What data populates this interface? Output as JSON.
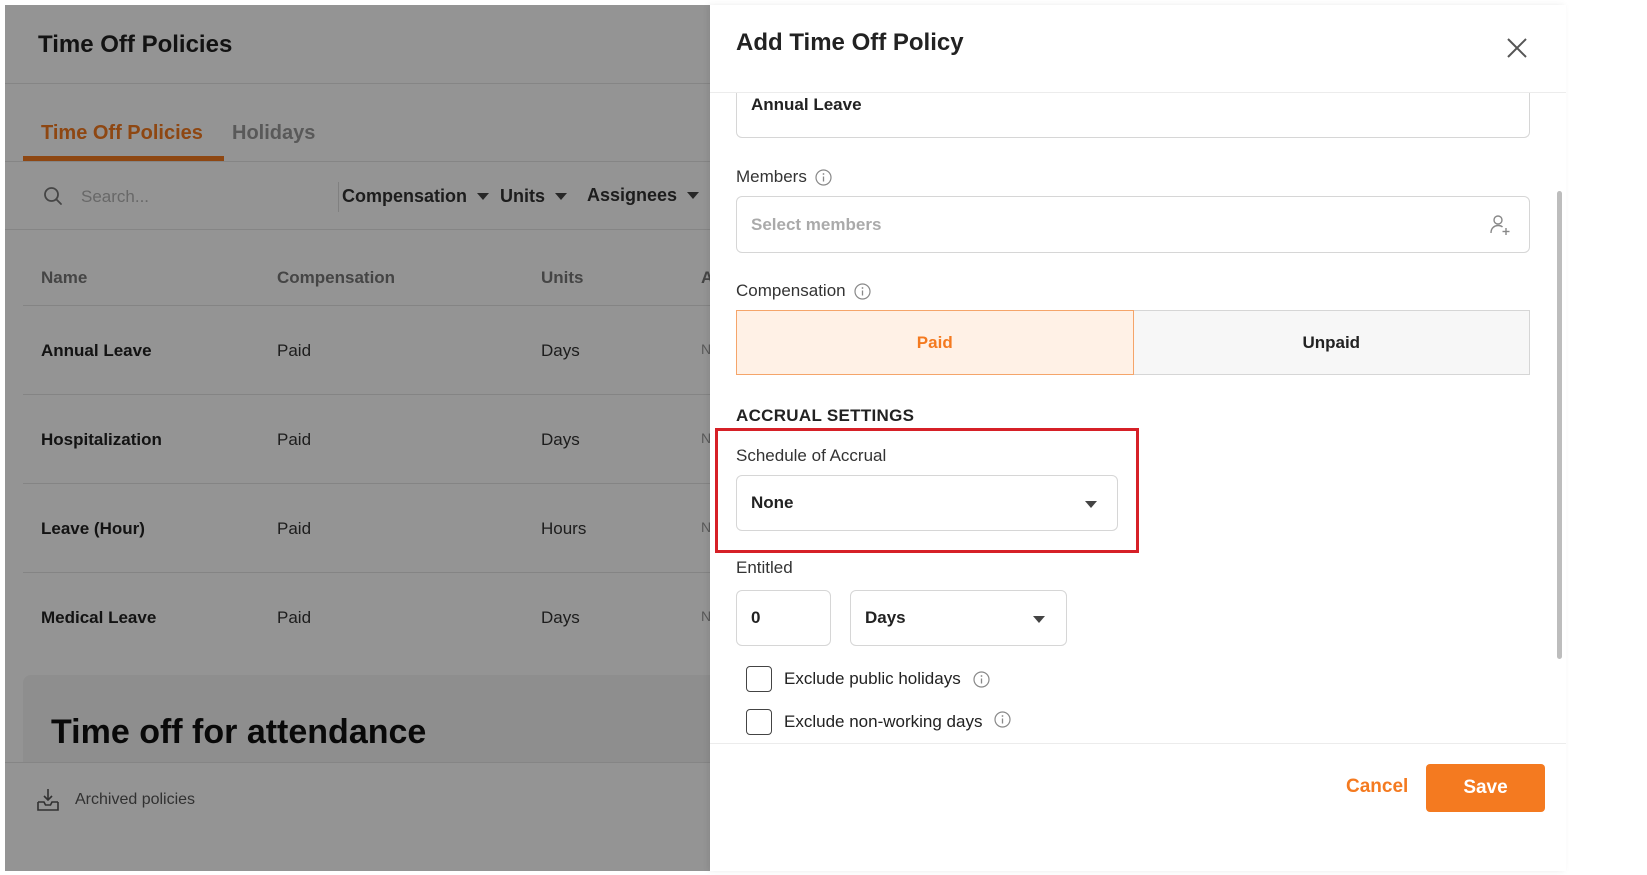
{
  "background": {
    "page_title": "Time Off Policies",
    "tabs": [
      {
        "label": "Time Off Policies",
        "active": true
      },
      {
        "label": "Holidays",
        "active": false
      }
    ],
    "search_placeholder": "Search...",
    "filters": [
      "Compensation",
      "Units",
      "Assignees"
    ],
    "table": {
      "headers": [
        "Name",
        "Compensation",
        "Units",
        "A"
      ],
      "rows": [
        {
          "name": "Annual Leave",
          "compensation": "Paid",
          "units": "Days",
          "more": "N"
        },
        {
          "name": "Hospitalization",
          "compensation": "Paid",
          "units": "Days",
          "more": "N"
        },
        {
          "name": "Leave (Hour)",
          "compensation": "Paid",
          "units": "Hours",
          "more": "N"
        },
        {
          "name": "Medical Leave",
          "compensation": "Paid",
          "units": "Days",
          "more": "N"
        }
      ]
    },
    "attendance_title": "Time off for attendance",
    "archived_label": "Archived policies"
  },
  "panel": {
    "title": "Add Time Off Policy",
    "name_value": "Annual Leave",
    "members": {
      "label": "Members",
      "placeholder": "Select members"
    },
    "compensation": {
      "label": "Compensation",
      "options": [
        "Paid",
        "Unpaid"
      ],
      "selected": "Paid"
    },
    "accrual": {
      "heading": "ACCRUAL SETTINGS",
      "schedule_label": "Schedule of Accrual",
      "schedule_value": "None"
    },
    "entitled": {
      "label": "Entitled",
      "value": "0",
      "unit": "Days"
    },
    "checkboxes": [
      {
        "label": "Exclude public holidays",
        "checked": false
      },
      {
        "label": "Exclude non-working days",
        "checked": false
      }
    ],
    "cancel_label": "Cancel",
    "save_label": "Save"
  },
  "colors": {
    "accent": "#f47a20",
    "highlight": "#d62027"
  }
}
